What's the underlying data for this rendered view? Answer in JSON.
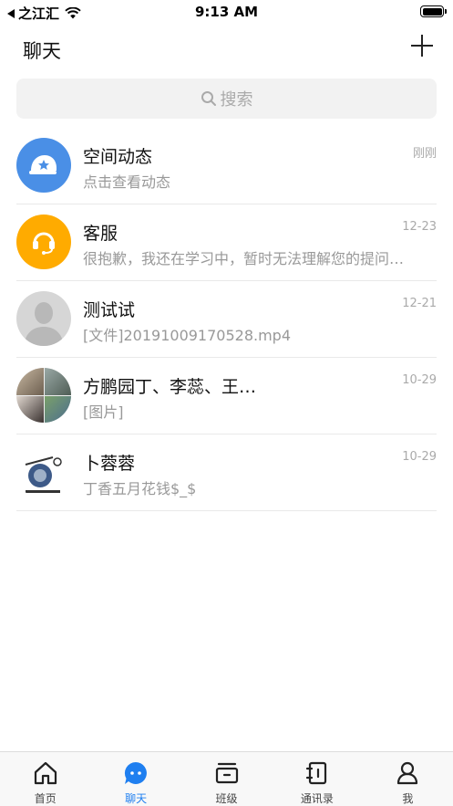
{
  "status_bar": {
    "back_app": "之江汇",
    "time": "9:13 AM"
  },
  "header": {
    "title": "聊天"
  },
  "search": {
    "placeholder": "搜索"
  },
  "chats": [
    {
      "name": "空间动态",
      "preview": "点击查看动态",
      "time": "刚刚",
      "avatar": "space-icon"
    },
    {
      "name": "客服",
      "preview": "很抱歉，我还在学习中，暂时无法理解您的提问…",
      "time": "12-23",
      "avatar": "headset-icon"
    },
    {
      "name": "测试试",
      "preview": "[文件]20191009170528.mp4",
      "time": "12-21",
      "avatar": "default-person-avatar"
    },
    {
      "name": "方鹏园丁、李蕊、王…",
      "preview": "[图片]",
      "time": "10-29",
      "avatar": "group-avatar"
    },
    {
      "name": "卜蓉蓉",
      "preview": "丁香五月花钱$_$",
      "time": "10-29",
      "avatar": "logo-avatar"
    }
  ],
  "tabs": [
    {
      "label": "首页",
      "icon": "home-icon",
      "active": false
    },
    {
      "label": "聊天",
      "icon": "chat-icon",
      "active": true
    },
    {
      "label": "班级",
      "icon": "class-icon",
      "active": false
    },
    {
      "label": "通讯录",
      "icon": "contacts-icon",
      "active": false
    },
    {
      "label": "我",
      "icon": "profile-icon",
      "active": false
    }
  ],
  "colors": {
    "accent": "#1f7ff0",
    "space_avatar": "#4a8fe6",
    "service_avatar": "#ffab00"
  }
}
